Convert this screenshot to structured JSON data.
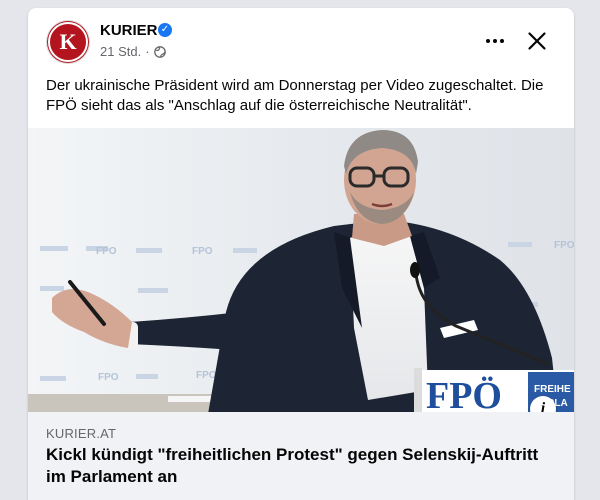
{
  "post": {
    "page_name": "KURIER",
    "avatar_letter": "K",
    "time": "21 Std.",
    "separator": "·",
    "caption": "Der ukrainische Präsident wird am Donnerstag per Video zugeschaltet. Die FPÖ sieht das als \"Anschlag auf die österreichische Neutralität\"."
  },
  "photo": {
    "backdrop_logo": "FPO",
    "sign_text": "FPÖ",
    "sign_side_1": "FREIHE",
    "sign_side_2": "PARLA"
  },
  "link": {
    "domain": "KURIER.AT",
    "headline": "Kickl kündigt \"freiheitlichen Protest\" gegen Selenskij-Auftritt im Parlament an"
  },
  "icons": {
    "verified": "verified-badge-icon",
    "globe": "globe-icon",
    "more": "more-options-icon",
    "close": "close-icon",
    "info": "info-icon"
  },
  "colors": {
    "brand_red": "#b3141d",
    "verified_blue": "#1877f2",
    "link_bg": "#f0f2f5"
  }
}
